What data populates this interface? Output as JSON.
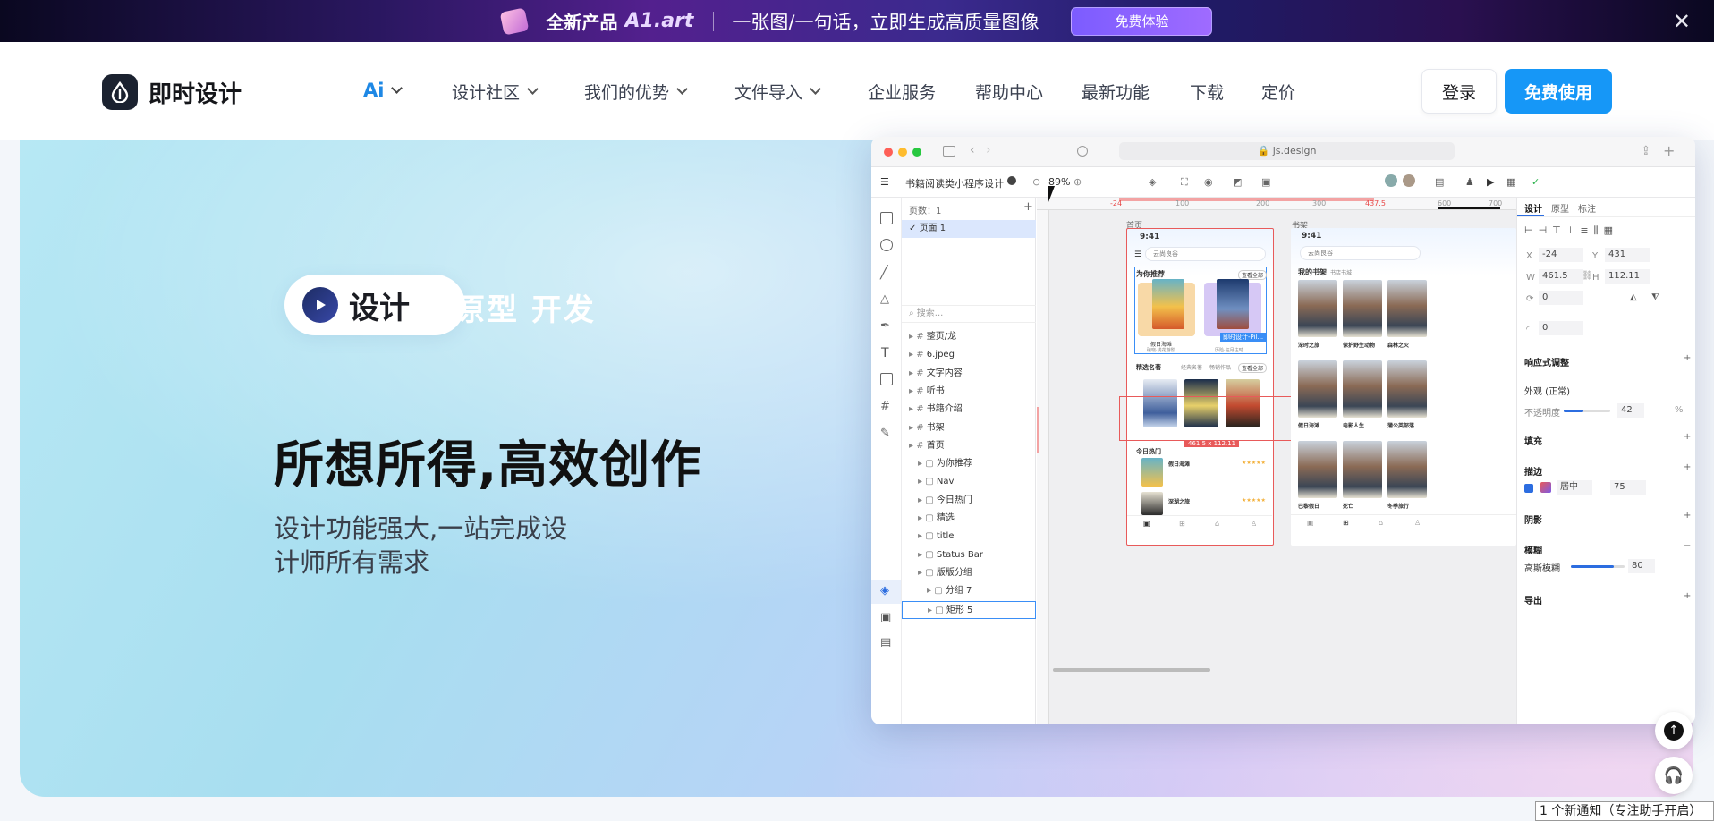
{
  "banner": {
    "product_prefix": "全新产品",
    "product_name": "A1.art",
    "slogan": "一张图/一句话，立即生成高质量图像",
    "cta": "免费体验",
    "close_icon": "close-icon"
  },
  "nav": {
    "logo_text": "即时设计",
    "items": [
      {
        "label": "Ai",
        "has_dropdown": true
      },
      {
        "label": "设计社区",
        "has_dropdown": true
      },
      {
        "label": "我们的优势",
        "has_dropdown": true
      },
      {
        "label": "文件导入",
        "has_dropdown": true
      },
      {
        "label": "企业服务",
        "has_dropdown": false
      },
      {
        "label": "帮助中心",
        "has_dropdown": false
      },
      {
        "label": "最新功能",
        "has_dropdown": false
      },
      {
        "label": "下载",
        "has_dropdown": false
      },
      {
        "label": "定价",
        "has_dropdown": false
      }
    ],
    "login": "登录",
    "free_use": "免费使用"
  },
  "hero": {
    "pill_active": "设计",
    "pill_rest": "原型 开发",
    "headline": "所想所得,高效创作",
    "subtitle_line1": "设计功能强大,一站完成设",
    "subtitle_line2": "计师所有需求"
  },
  "app": {
    "url": "js.design",
    "file_name": "书籍阅读类小程序设计",
    "zoom": "89%",
    "pages_label": "页数：1",
    "page_item": "页面 1",
    "search_placeholder": "搜索...",
    "layers": [
      {
        "label": "整页/龙",
        "indent": 0
      },
      {
        "label": "6.jpeg",
        "indent": 0
      },
      {
        "label": "文字内容",
        "indent": 0
      },
      {
        "label": "听书",
        "indent": 0
      },
      {
        "label": "书籍介绍",
        "indent": 0
      },
      {
        "label": "书架",
        "indent": 0
      },
      {
        "label": "首页",
        "indent": 0
      },
      {
        "label": "为你推荐",
        "indent": 1
      },
      {
        "label": "Nav",
        "indent": 1
      },
      {
        "label": "今日热门",
        "indent": 1
      },
      {
        "label": "精选",
        "indent": 1
      },
      {
        "label": "title",
        "indent": 1
      },
      {
        "label": "Status Bar",
        "indent": 1
      },
      {
        "label": "版版分组",
        "indent": 1
      },
      {
        "label": "分组 7",
        "indent": 2
      },
      {
        "label": "矩形 5",
        "indent": 2
      }
    ],
    "ruler_marks": [
      "-24",
      "100",
      "200",
      "300",
      "437.5",
      "600",
      "700"
    ],
    "frame_labels": {
      "home": "首页",
      "shelf": "书架"
    },
    "phone": {
      "time": "9:41",
      "search": "云尚良谷",
      "section_recommend": "为你推荐",
      "see_all": "查看全部",
      "book1": "假日海滩",
      "book1_sub": "破晓·浅花游影",
      "book2_sub": "历险·狂月往时",
      "selection": "精选名著",
      "tab2": "经典名著",
      "tab3": "畅销作品",
      "hot": "今日热门",
      "hot1": "假日海滩",
      "hot2": "深湖之旅",
      "size_badge": "461.5 x 112.11",
      "hover_label": "即时设计-Pil..."
    },
    "shelf_phone": {
      "time": "9:41",
      "search": "云尚良谷",
      "title": "我的书架",
      "tab": "书店书城",
      "row1": [
        "深时之旅",
        "保护野生动物",
        "森林之火"
      ],
      "row2": [
        "假日海滩",
        "电影人生",
        "蒲公英部落"
      ],
      "row3": [
        "巴黎假日",
        "死亡",
        "冬季旅行"
      ]
    },
    "panel": {
      "tabs": [
        "设计",
        "原型",
        "标注"
      ],
      "x_label": "X",
      "x": "-24",
      "y_label": "Y",
      "y": "431",
      "w_label": "W",
      "w": "461.5",
      "h_label": "H",
      "h": "112.11",
      "rotation": "0",
      "radius": "0",
      "responsive": "响应式调整",
      "appearance": "外观 (正常)",
      "opacity_label": "不透明度",
      "opacity": "42",
      "fill": "填充",
      "stroke": "描边",
      "stroke_pos": "居中",
      "stroke_width": "75",
      "shadow": "阴影",
      "blur": "模糊",
      "blur_type": "高斯模糊",
      "blur_value": "80",
      "export": "导出"
    }
  },
  "notification": "1 个新通知（专注助手开启）",
  "colors": {
    "accent": "#1697f7",
    "selection": "#e84a4a",
    "hero_text": "#111111"
  }
}
